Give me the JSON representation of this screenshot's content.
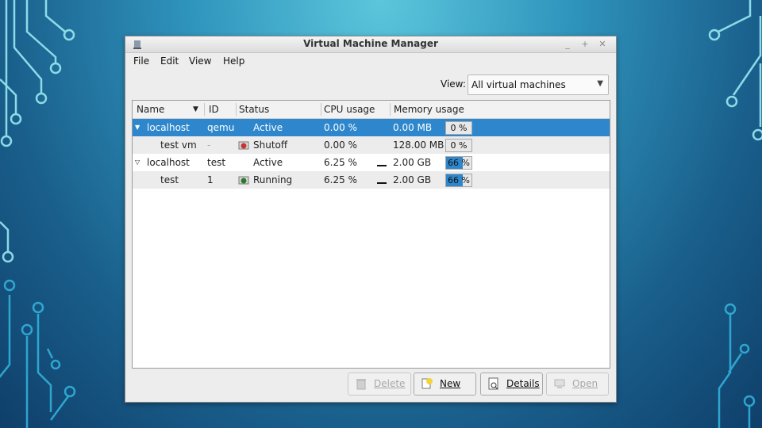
{
  "window": {
    "title": "Virtual Machine Manager"
  },
  "menu": {
    "file": "File",
    "edit": "Edit",
    "view": "View",
    "help": "Help"
  },
  "view_filter": {
    "label": "View:",
    "value": "All virtual machines"
  },
  "table": {
    "columns": [
      "Name",
      "ID",
      "Status",
      "CPU usage",
      "Memory usage"
    ],
    "rows": [
      {
        "name": "localhost",
        "id": "qemu",
        "status": "Active",
        "cpu": "0.00 %",
        "memory": "0.00 MB",
        "mem_pct": "0 %",
        "mem_fraction": 0
      },
      {
        "name": "test vm",
        "id": "-",
        "status": "Shutoff",
        "cpu": "0.00 %",
        "memory": "128.00 MB",
        "mem_pct": "0 %",
        "mem_fraction": 0
      },
      {
        "name": "localhost",
        "id": "test",
        "status": "Active",
        "cpu": "6.25 %",
        "memory": "2.00 GB",
        "mem_pct": "66 %",
        "mem_fraction": 0.66
      },
      {
        "name": "test",
        "id": "1",
        "status": "Running",
        "cpu": "6.25 %",
        "memory": "2.00 GB",
        "mem_pct": "66 %",
        "mem_fraction": 0.66
      }
    ]
  },
  "buttons": {
    "delete": "Delete",
    "new": "New",
    "details": "Details",
    "open": "Open"
  },
  "colors": {
    "selection": "#2e87cc",
    "window_bg": "#ededed"
  },
  "icons": {
    "window": "vm-manager-icon",
    "shutoff": "shutoff-icon",
    "running": "running-icon",
    "delete": "trash-icon",
    "new": "new-vm-icon",
    "details": "details-icon",
    "open": "monitor-icon"
  }
}
